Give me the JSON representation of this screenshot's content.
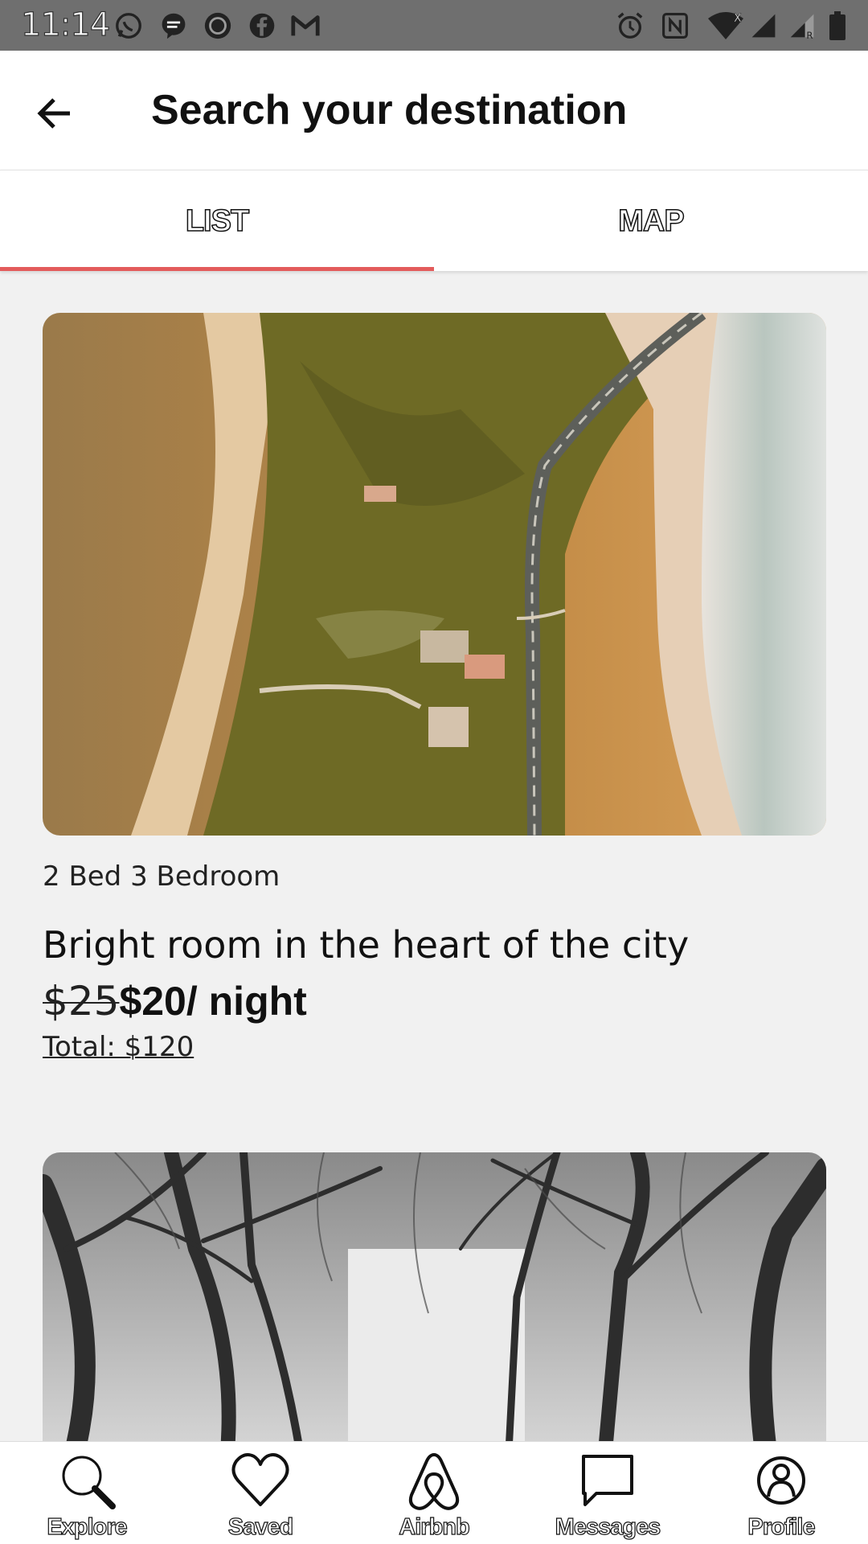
{
  "status_bar": {
    "time": "11:14",
    "left_icons": [
      "whatsapp-icon",
      "messenger-icon",
      "record-icon",
      "facebook-icon",
      "gmail-icon"
    ],
    "right_icons": [
      "alarm-icon",
      "nfc-icon",
      "wifi-icon",
      "signal-icon",
      "signal-roaming-icon",
      "battery-icon"
    ]
  },
  "header": {
    "title": "Search your destination",
    "back_icon": "arrow-left-icon"
  },
  "tabs": [
    {
      "label": "LIST",
      "selected": true
    },
    {
      "label": "MAP",
      "selected": false
    }
  ],
  "accent_color": "#e35b5b",
  "listings": [
    {
      "subtitle": "2 Bed 3 Bedroom",
      "title": "Bright room in the heart of the city",
      "price_old": "$25",
      "price_new": "$20/ night",
      "total": "Total: $120",
      "image": "aerial-beach-photo"
    },
    {
      "image": "winter-forest-photo"
    }
  ],
  "bottom_nav": [
    {
      "label": "Explore",
      "icon": "search-icon"
    },
    {
      "label": "Saved",
      "icon": "heart-icon"
    },
    {
      "label": "Airbnb",
      "icon": "airbnb-logo-icon"
    },
    {
      "label": "Messages",
      "icon": "message-icon"
    },
    {
      "label": "Profile",
      "icon": "profile-icon"
    }
  ]
}
